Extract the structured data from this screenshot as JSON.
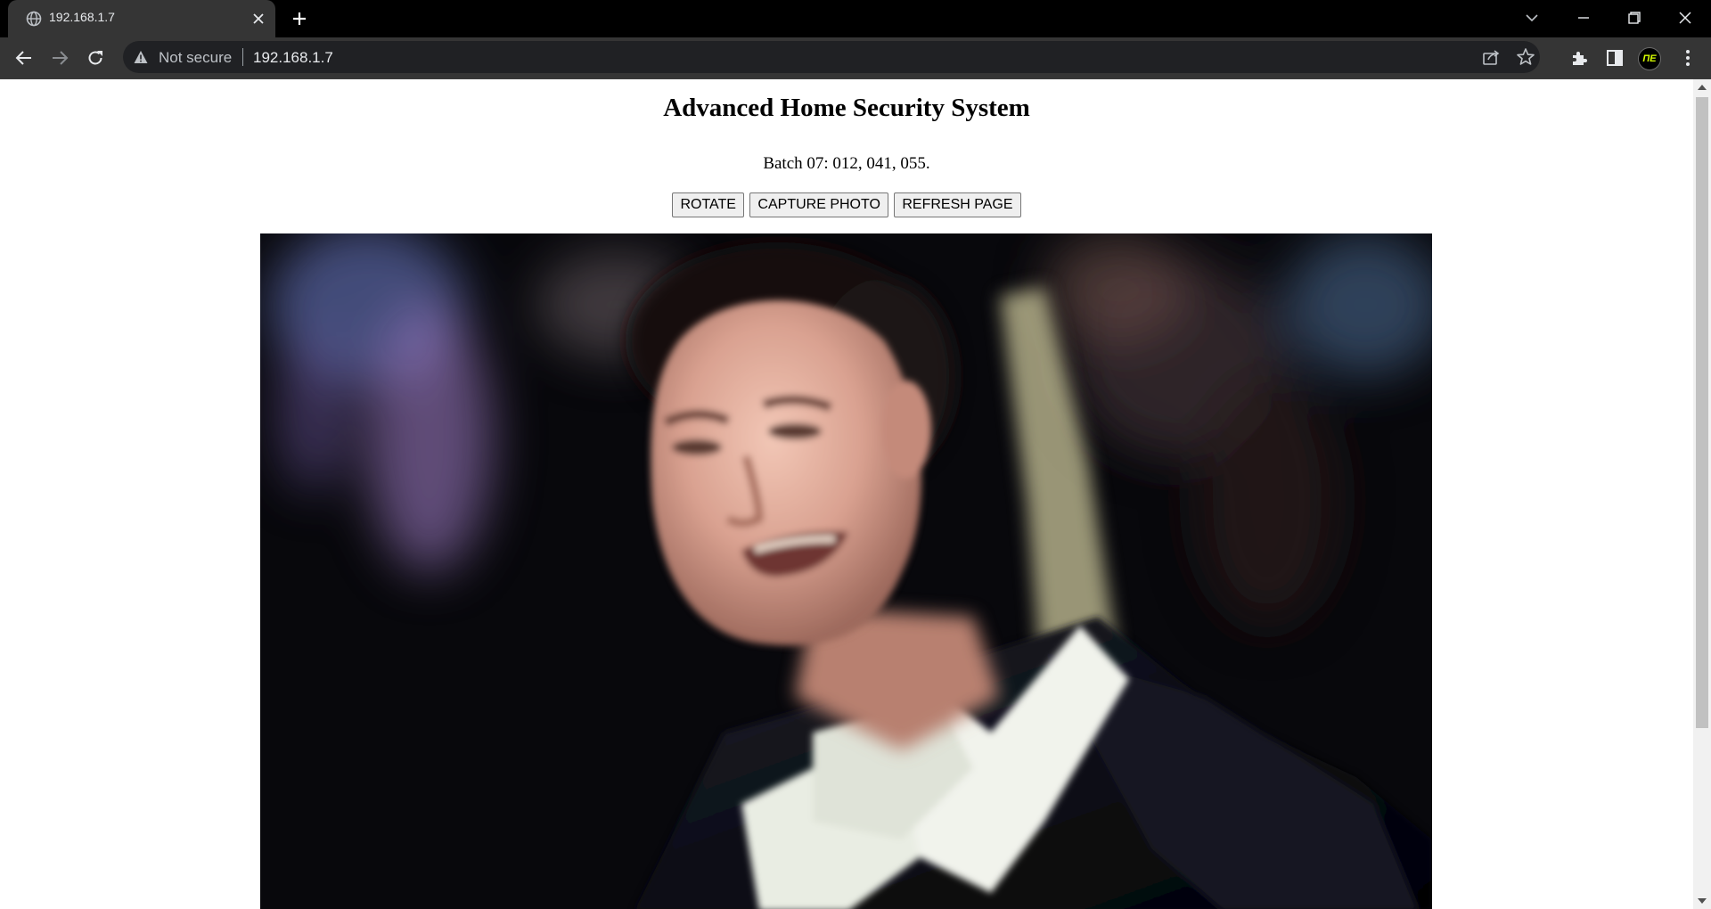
{
  "browser": {
    "tab_title": "192.168.1.7",
    "security_label": "Not secure",
    "url": "192.168.1.7",
    "profile_initials": "ΠE"
  },
  "page": {
    "title": "Advanced Home Security System",
    "batch_text": "Batch 07: 012, 041, 055.",
    "buttons": {
      "rotate": "ROTATE",
      "capture": "CAPTURE PHOTO",
      "refresh": "REFRESH PAGE"
    }
  },
  "colors": {
    "chrome_dark": "#000000",
    "toolbar": "#353535",
    "omnibox": "#202124",
    "page_bg": "#ffffff"
  }
}
